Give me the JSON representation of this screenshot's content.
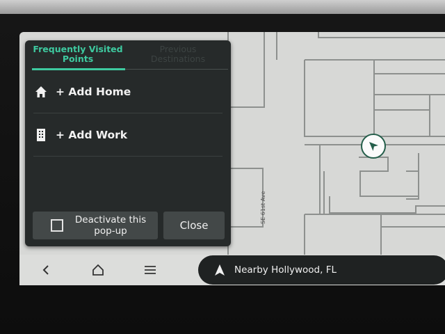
{
  "popup": {
    "tabs": [
      {
        "label_line1": "Frequently Visited",
        "label_line2": "Points",
        "active": true
      },
      {
        "label_line1": "Previous",
        "label_line2": "Destinations",
        "active": false
      }
    ],
    "items": [
      {
        "icon": "home-icon",
        "label": "+ Add Home"
      },
      {
        "icon": "building-icon",
        "label": "+ Add Work"
      }
    ],
    "deactivate_line1": "Deactivate this",
    "deactivate_line2": "pop-up",
    "close_label": "Close"
  },
  "map": {
    "street_label": "SE 61st Ave"
  },
  "navbar": {
    "back_icon": "back-icon",
    "home_icon": "home-outline-icon",
    "menu_icon": "menu-icon",
    "location_text": "Nearby Hollywood, FL"
  },
  "colors": {
    "accent": "#3ecaa0",
    "panel": "#262a2a",
    "map": "#d7d8d6",
    "marker": "#245e4a"
  }
}
